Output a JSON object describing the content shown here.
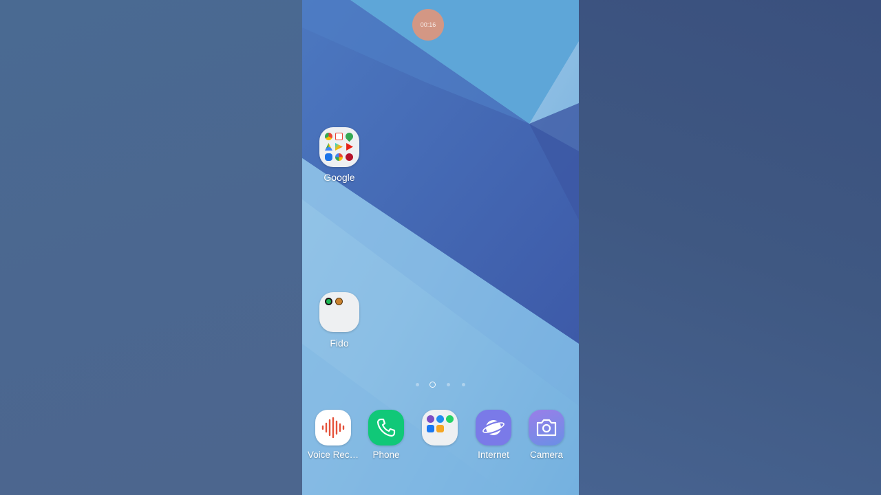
{
  "recording": {
    "timer": "00:16"
  },
  "home": {
    "folders": [
      {
        "label": "Google",
        "apps": [
          "chrome-icon",
          "gmail-icon",
          "maps-icon",
          "drive-icon",
          "play-store-icon",
          "youtube-icon",
          "duo-icon",
          "photos-icon",
          "youtube-music-icon"
        ]
      },
      {
        "label": "Fido",
        "apps": [
          "spotify-icon",
          "game-icon"
        ]
      }
    ],
    "page_indicator": {
      "pages": 4,
      "current": 2
    }
  },
  "dock": [
    {
      "label": "Voice Rec…",
      "icon": "voice-recorder-icon"
    },
    {
      "label": "Phone",
      "icon": "phone-icon"
    },
    {
      "label": "",
      "icon": "social-folder-icon"
    },
    {
      "label": "Internet",
      "icon": "internet-icon"
    },
    {
      "label": "Camera",
      "icon": "camera-icon"
    }
  ],
  "colors": {
    "phone_green": "#10c878",
    "internet_purple": "#7a7ae8",
    "camera_purple": "#7f86e6",
    "recorder_red": "#e5523a"
  }
}
